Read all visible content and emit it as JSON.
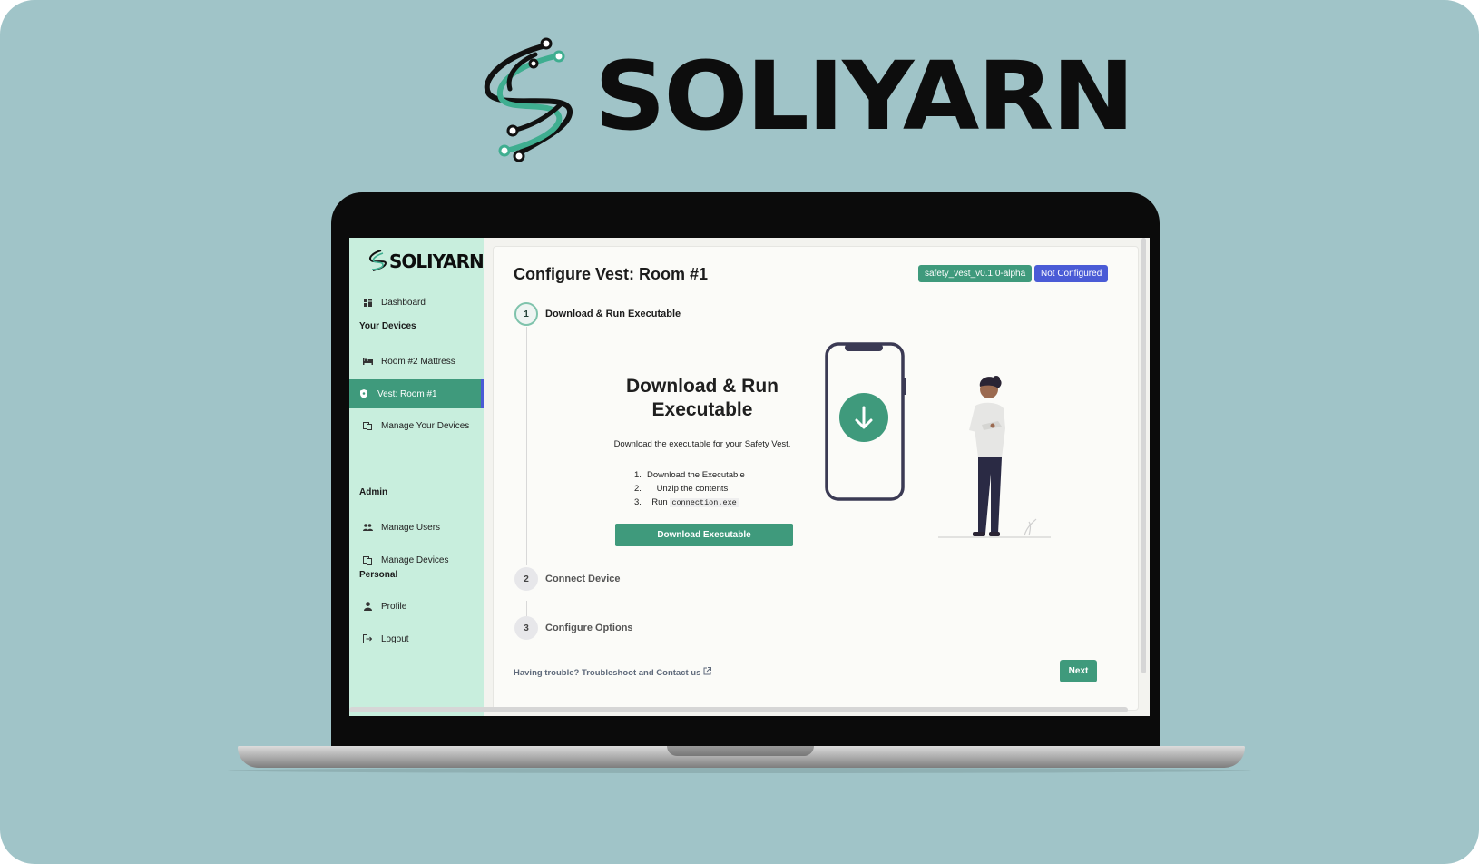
{
  "brand": {
    "name": "SOLIYARN"
  },
  "sidebar": {
    "items": [
      {
        "label": "Dashboard"
      },
      {
        "label": "Room #2 Mattress"
      },
      {
        "label": "Vest: Room #1"
      },
      {
        "label": "Manage Your Devices"
      },
      {
        "label": "Manage Users"
      },
      {
        "label": "Manage Devices"
      },
      {
        "label": "Profile"
      },
      {
        "label": "Logout"
      }
    ],
    "sections": {
      "devices": "Your Devices",
      "admin": "Admin",
      "personal": "Personal"
    },
    "active_item": "Vest: Room #1"
  },
  "header": {
    "title": "Configure Vest: Room #1",
    "version_badge": "safety_vest_v0.1.0-alpha",
    "status_badge": "Not Configured"
  },
  "steps": [
    {
      "number": "1",
      "label": "Download & Run Executable"
    },
    {
      "number": "2",
      "label": "Connect Device"
    },
    {
      "number": "3",
      "label": "Configure Options"
    }
  ],
  "download": {
    "title_line1": "Download & Run",
    "title_line2": "Executable",
    "description": "Download the executable for your Safety Vest.",
    "instructions": [
      {
        "n": "1.",
        "text": "Download the Executable"
      },
      {
        "n": "2.",
        "text": "Unzip the contents"
      },
      {
        "n": "3.",
        "text": "Run",
        "code": "connection.exe"
      }
    ],
    "button": "Download Executable"
  },
  "footer": {
    "help_link": "Having trouble? Troubleshoot and Contact us",
    "next_button": "Next"
  },
  "colors": {
    "background": "#a0c4c8",
    "sidebar": "#c8eedd",
    "accent_green": "#3f9a7c",
    "status_blue": "#4a5bd6"
  }
}
